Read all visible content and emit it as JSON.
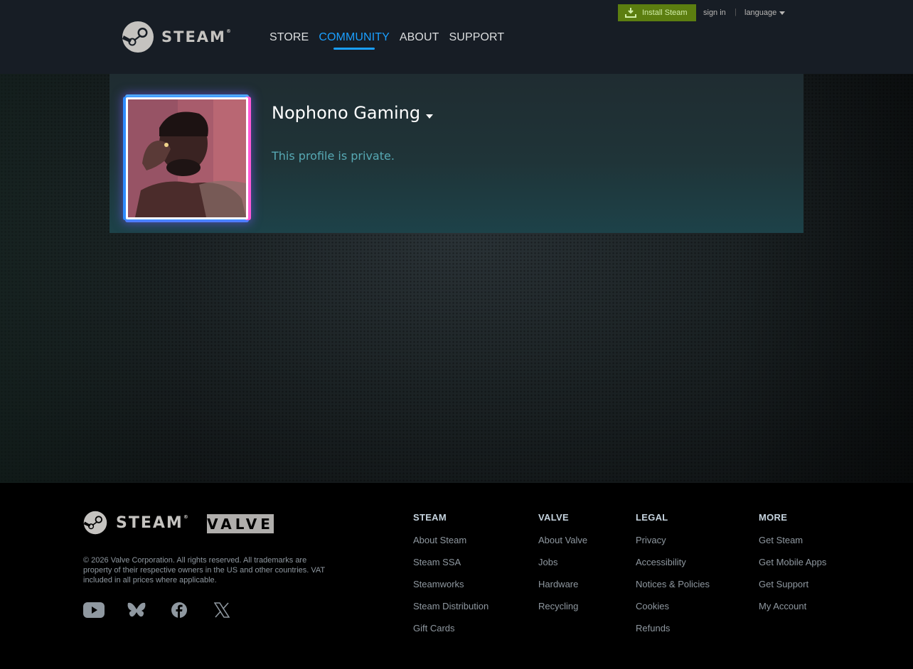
{
  "header": {
    "logo_text": "STEAM",
    "logo_reg": "®",
    "nav": [
      "Store",
      "Community",
      "About",
      "Support"
    ],
    "active_nav": "Community",
    "install_label": "Install Steam",
    "signin_label": "sign in",
    "separator": "|",
    "language_label": "language"
  },
  "profile": {
    "persona_name": "Nophono Gaming",
    "private_message": "This profile is private."
  },
  "footer": {
    "steam_logo_text": "STEAM",
    "valve_logo_text": "VALVE",
    "copyright": "© 2026 Valve Corporation. All rights reserved. All trademarks are property of their respective owners in the US and other countries. VAT included in all prices where applicable.",
    "social": [
      "youtube-icon",
      "bluesky-icon",
      "facebook-icon",
      "x-icon"
    ],
    "columns": [
      {
        "title": "STEAM",
        "links": [
          "About Steam",
          "Steam SSA",
          "Steamworks",
          "Steam Distribution",
          "Gift Cards"
        ]
      },
      {
        "title": "VALVE",
        "links": [
          "About Valve",
          "Jobs",
          "Hardware",
          "Recycling"
        ]
      },
      {
        "title": "LEGAL",
        "links": [
          "Privacy",
          "Accessibility",
          "Notices & Policies",
          "Cookies",
          "Refunds"
        ]
      },
      {
        "title": "MORE",
        "links": [
          "Get Steam",
          "Get Mobile Apps",
          "Get Support",
          "My Account"
        ]
      }
    ]
  },
  "colors": {
    "accent_blue": "#1a9fff",
    "install_green": "#5c7e10",
    "private_text": "#57a9b4"
  }
}
